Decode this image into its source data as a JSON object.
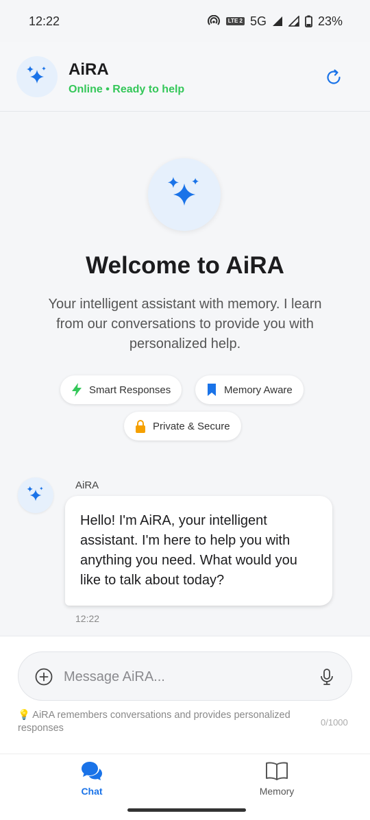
{
  "status_bar": {
    "time": "12:22",
    "network": "5G",
    "lte": "LTE 2",
    "battery": "23%"
  },
  "header": {
    "title": "AiRA",
    "status": "Online • Ready to help"
  },
  "welcome": {
    "title": "Welcome to AiRA",
    "description": "Your intelligent assistant with memory. I learn from our conversations to provide you with personalized help.",
    "features": [
      {
        "label": "Smart Responses",
        "icon": "lightning-icon",
        "color": "#34c759"
      },
      {
        "label": "Memory Aware",
        "icon": "bookmark-icon",
        "color": "#1a73e8"
      },
      {
        "label": "Private & Secure",
        "icon": "lock-icon",
        "color": "#f5a000"
      }
    ]
  },
  "messages": [
    {
      "sender": "AiRA",
      "text": "Hello! I'm AiRA, your intelligent assistant. I'm here to help you with anything you need. What would you like to talk about today?",
      "time": "12:22"
    }
  ],
  "composer": {
    "placeholder": "Message AiRA...",
    "hint": "💡 AiRA remembers conversations and provides personalized responses",
    "char_count": "0/1000"
  },
  "nav": {
    "items": [
      {
        "label": "Chat",
        "active": true
      },
      {
        "label": "Memory",
        "active": false
      }
    ]
  },
  "colors": {
    "accent": "#1a73e8",
    "online": "#34c759",
    "avatar_bg": "#e6f0fc"
  }
}
